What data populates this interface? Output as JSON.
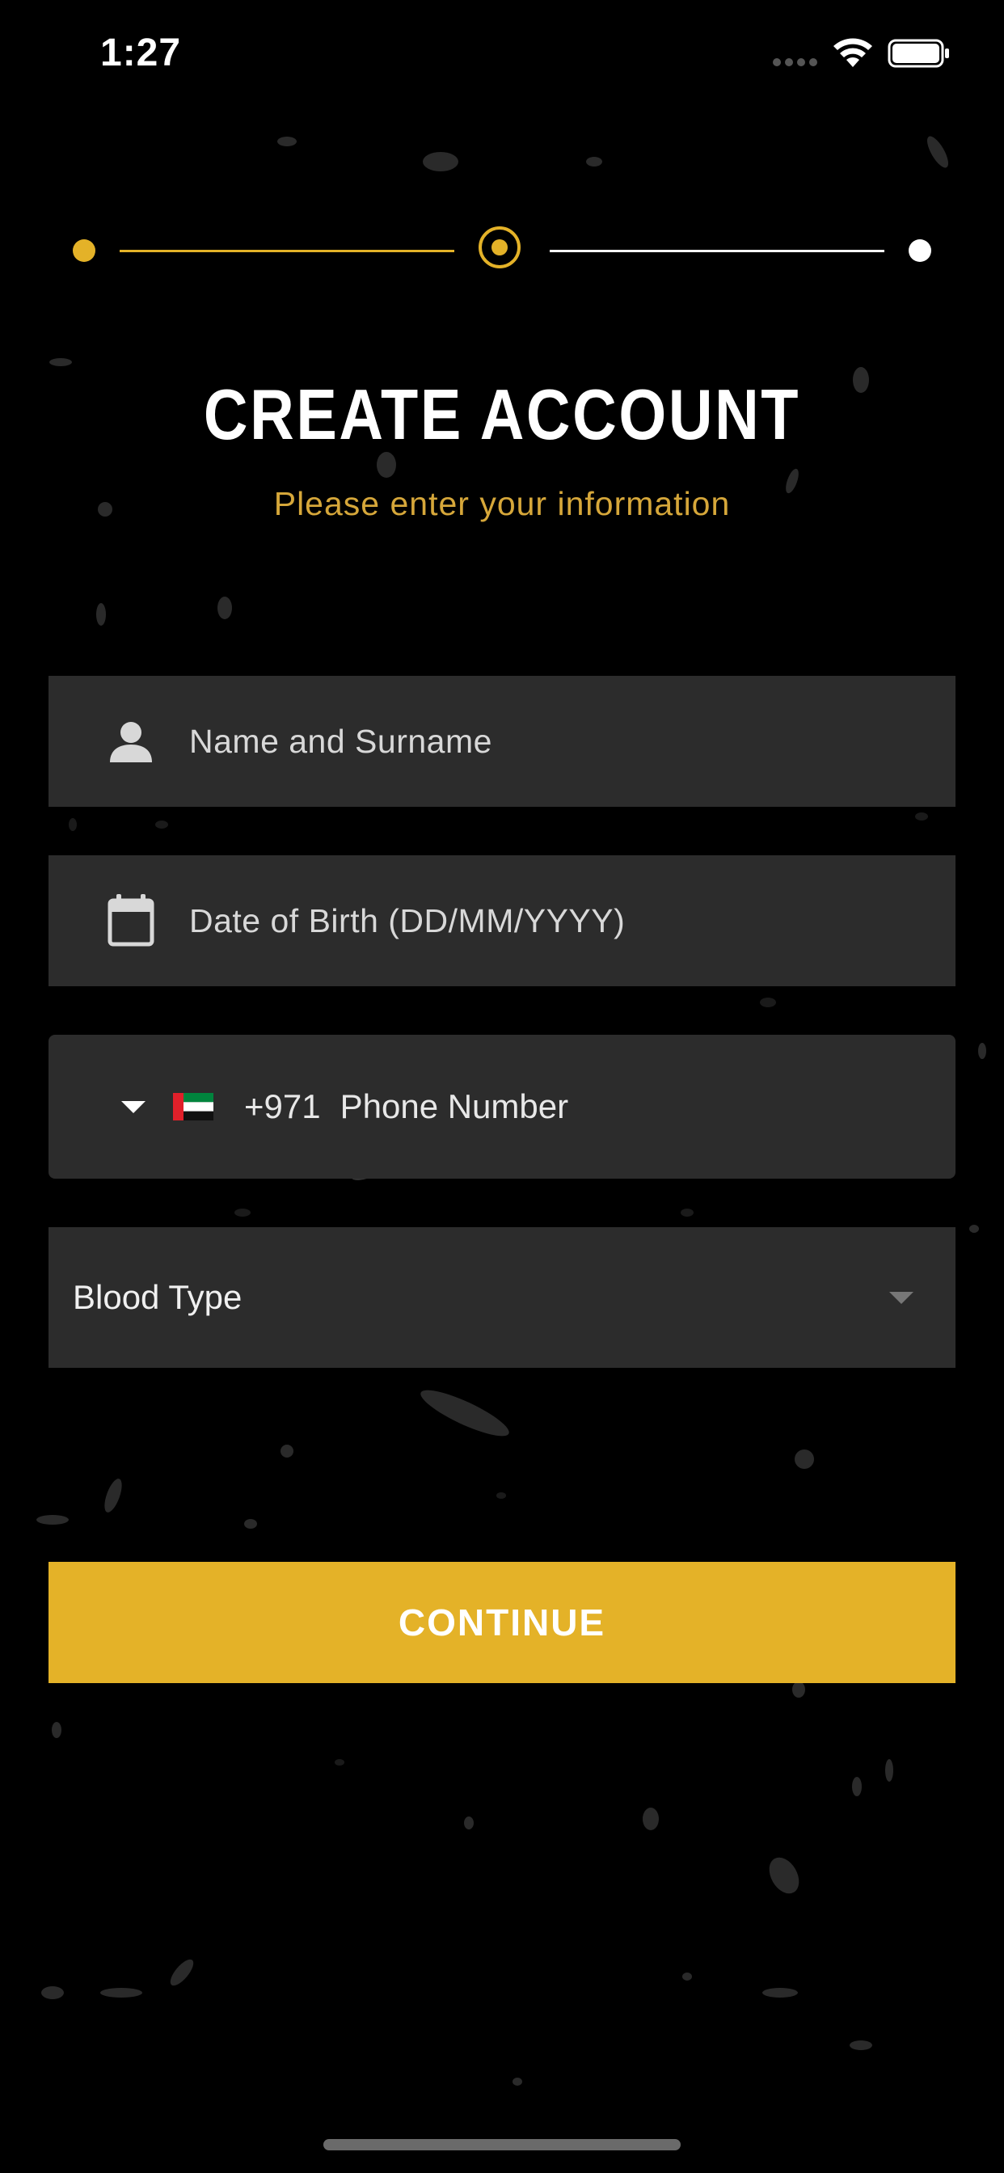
{
  "status_bar": {
    "time": "1:27"
  },
  "stepper": {
    "total_steps": 3,
    "current_step": 2,
    "active_color": "#e4b228",
    "inactive_color": "#ffffff"
  },
  "header": {
    "title": "CREATE ACCOUNT",
    "subtitle": "Please enter your information"
  },
  "form": {
    "name": {
      "placeholder": "Name and Surname",
      "icon": "person-icon"
    },
    "dob": {
      "placeholder": "Date of Birth (DD/MM/YYYY)",
      "icon": "calendar-icon"
    },
    "phone": {
      "country_flag": "uae-flag-icon",
      "dial_code": "+971",
      "placeholder": "Phone Number"
    },
    "blood_type": {
      "label": "Blood Type",
      "icon": "chevron-down-icon"
    }
  },
  "actions": {
    "continue_label": "CONTINUE"
  },
  "colors": {
    "accent": "#e4b228",
    "field_background": "#2c2c2c",
    "background": "#000000"
  }
}
